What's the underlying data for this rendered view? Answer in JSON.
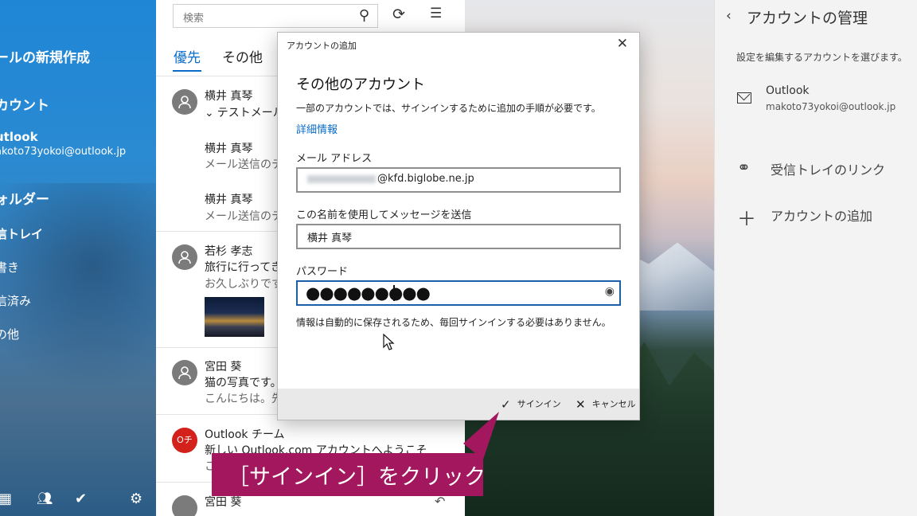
{
  "left_nav": {
    "new_mail": "ールの新規作成",
    "accounts_heading": "カウント",
    "account_name": "utlook",
    "account_email": "akoto73yokoi@outlook.jp",
    "folders_heading": "ォルダー",
    "folders": [
      "信トレイ",
      "書き",
      "信済み",
      "の他"
    ],
    "bottom_icons": [
      "calendar-icon",
      "people-icon",
      "todo-icon",
      "settings-icon"
    ]
  },
  "mail_list": {
    "search_placeholder": "検索",
    "tabs": [
      "優先",
      "その他"
    ],
    "messages": [
      {
        "sender": "横井 真琴",
        "subject": "テストメール",
        "preview": ""
      },
      {
        "sender": "横井 真琴",
        "subject": "",
        "preview": "メール送信のテス"
      },
      {
        "sender": "横井 真琴",
        "subject": "",
        "preview": "メール送信のテス"
      },
      {
        "sender": "若杉 孝志",
        "subject": "旅行に行ってきま",
        "preview": "お久しぶりです。"
      },
      {
        "sender": "宮田 葵",
        "subject": "猫の写真です。",
        "preview": "こんにちは。先"
      },
      {
        "sender": "Outlook チーム",
        "subject": "新しい Outlook.com アカウントへようこそ",
        "preview": "こ"
      },
      {
        "sender": "宮田 葵",
        "subject": "",
        "preview": ""
      }
    ],
    "outlook_avatar_text": "Oチ"
  },
  "dialog": {
    "title": "アカウントの追加",
    "heading": "その他のアカウント",
    "description": "一部のアカウントでは、サインインするために追加の手順が必要です。",
    "details_link": "詳細情報",
    "email_label": "メール アドレス",
    "email_value": "@kfd.biglobe.ne.jp",
    "name_label": "この名前を使用してメッセージを送信",
    "name_value": "横井 真琴",
    "password_label": "パスワード",
    "password_value": "●●●●●●●●●",
    "note": "情報は自動的に保存されるため、毎回サインインする必要はありません。",
    "sign_in_button": "サインイン",
    "cancel_button": "キャンセル"
  },
  "right_pane": {
    "title": "アカウントの管理",
    "instruction": "設定を編集するアカウントを選びます。",
    "account_name": "Outlook",
    "account_email": "makoto73yokoi@outlook.jp",
    "link_inbox": "受信トレイのリンク",
    "add_account": "アカウントの追加"
  },
  "callout": {
    "text": "［サインイン］をクリック",
    "color": "#a3175f"
  }
}
